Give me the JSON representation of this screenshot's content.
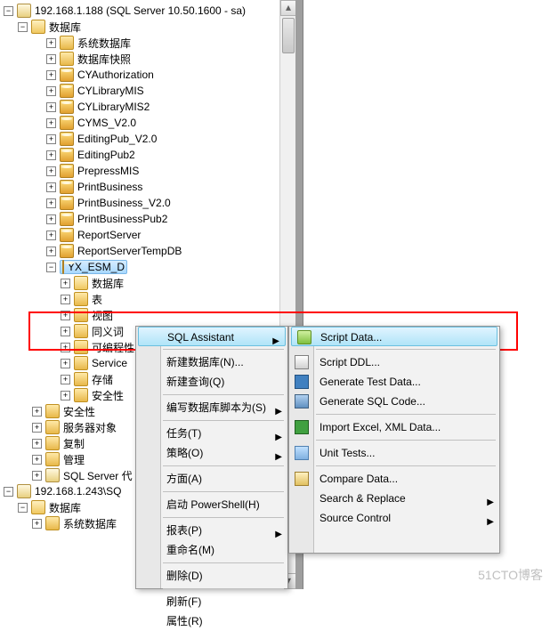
{
  "server1": {
    "label": "192.168.1.188 (SQL Server 10.50.1600 - sa)",
    "databases_label": "数据库",
    "items": [
      {
        "type": "folder",
        "label": "系统数据库",
        "indent": 3
      },
      {
        "type": "folder",
        "label": "数据库快照",
        "indent": 3
      },
      {
        "type": "db",
        "label": "CYAuthorization",
        "indent": 3
      },
      {
        "type": "db",
        "label": "CYLibraryMIS",
        "indent": 3
      },
      {
        "type": "db",
        "label": "CYLibraryMIS2",
        "indent": 3
      },
      {
        "type": "db",
        "label": "CYMS_V2.0",
        "indent": 3
      },
      {
        "type": "db",
        "label": "EditingPub_V2.0",
        "indent": 3
      },
      {
        "type": "db",
        "label": "EditingPub2",
        "indent": 3
      },
      {
        "type": "db",
        "label": "PrepressMIS",
        "indent": 3
      },
      {
        "type": "db",
        "label": "PrintBusiness",
        "indent": 3
      },
      {
        "type": "db",
        "label": "PrintBusiness_V2.0",
        "indent": 3
      },
      {
        "type": "db",
        "label": "PrintBusinessPub2",
        "indent": 3
      },
      {
        "type": "db",
        "label": "ReportServer",
        "indent": 3
      },
      {
        "type": "db",
        "label": "ReportServerTempDB",
        "indent": 3
      }
    ],
    "selected_db": "YX_ESM_D",
    "sub_items": [
      {
        "type": "folder-open",
        "label": "数据库",
        "indent": 4,
        "cut": true
      },
      {
        "type": "folder",
        "label": "表",
        "indent": 4
      },
      {
        "type": "folder",
        "label": "视图",
        "indent": 4
      },
      {
        "type": "folder",
        "label": "同义词",
        "indent": 4
      },
      {
        "type": "folder",
        "label": "可编程性",
        "indent": 4,
        "cut": true
      },
      {
        "type": "folder",
        "label": "Service",
        "indent": 4,
        "cut": true
      },
      {
        "type": "folder",
        "label": "存储",
        "indent": 4
      },
      {
        "type": "folder",
        "label": "安全性",
        "indent": 4
      }
    ],
    "bottom_items": [
      {
        "type": "folder",
        "label": "安全性",
        "indent": 2
      },
      {
        "type": "folder",
        "label": "服务器对象",
        "indent": 2
      },
      {
        "type": "folder",
        "label": "复制",
        "indent": 2
      },
      {
        "type": "folder",
        "label": "管理",
        "indent": 2
      },
      {
        "type": "server",
        "label": "SQL Server 代",
        "indent": 2,
        "cut": true
      }
    ]
  },
  "server2": {
    "label": "192.168.1.243\\SQ",
    "databases_label": "数据库",
    "child": "系统数据库"
  },
  "context_menu": {
    "highlighted": "SQL Assistant",
    "items": [
      "新建数据库(N)...",
      "新建查询(Q)",
      "编写数据库脚本为(S)",
      "任务(T)",
      "策略(O)",
      "方面(A)",
      "启动 PowerShell(H)",
      "报表(P)",
      "重命名(M)",
      "删除(D)",
      "刷新(F)",
      "属性(R)"
    ]
  },
  "submenu": {
    "highlighted": "Script Data...",
    "items": [
      "Script DDL...",
      "Generate Test Data...",
      "Generate SQL Code...",
      "Import Excel, XML Data...",
      "Unit Tests...",
      "Compare Data...",
      "Search & Replace",
      "Source Control"
    ]
  },
  "watermark": "51CTO博客"
}
